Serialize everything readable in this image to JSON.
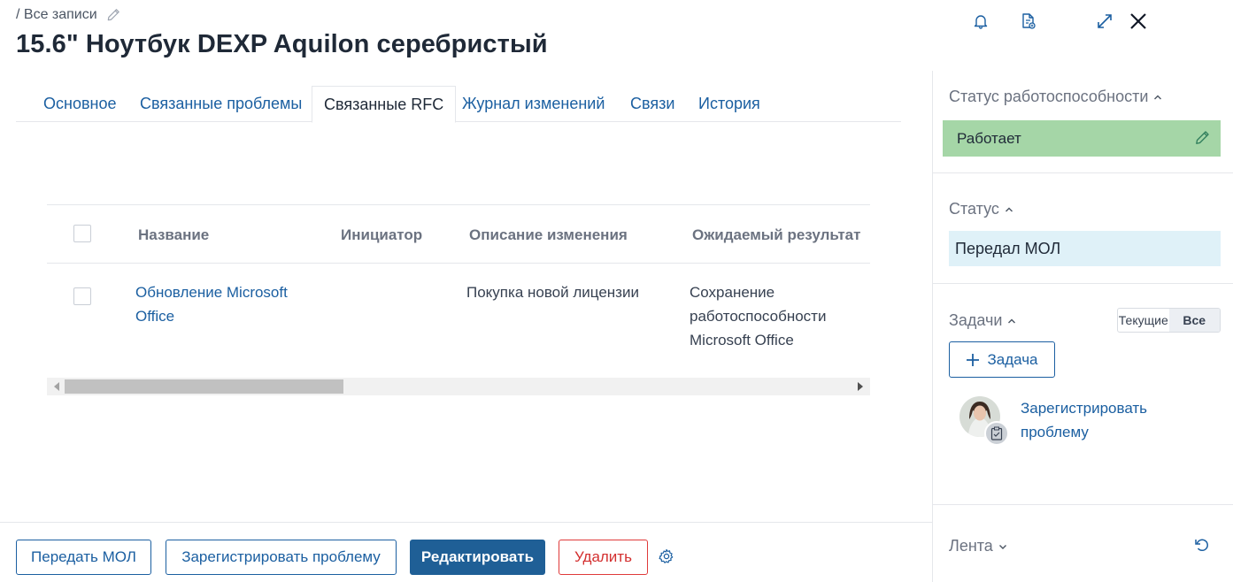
{
  "breadcrumb": {
    "text": "/ Все записи"
  },
  "title": "15.6\" Ноутбук DEXP Aquilon серебристый",
  "tabs": [
    {
      "label": "Основное"
    },
    {
      "label": "Связанные проблемы"
    },
    {
      "label": "Связанные RFC",
      "active": true
    },
    {
      "label": "Журнал изменений"
    },
    {
      "label": "Связи"
    },
    {
      "label": "История"
    }
  ],
  "table": {
    "columns": [
      "Название",
      "Инициатор",
      "Описание изменения",
      "Ожидаемый результат"
    ],
    "rows": [
      {
        "name_line1": "Обновление Microsoft",
        "name_line2": "Office",
        "initiator": "",
        "description": "Покупка новой лицензии",
        "result_line1": "Сохранение",
        "result_line2": "работоспособности",
        "result_line3": "Microsoft Office"
      }
    ]
  },
  "footer": {
    "transfer": "Передать МОЛ",
    "register": "Зарегистрировать проблему",
    "edit": "Редактировать",
    "delete": "Удалить"
  },
  "sidebar": {
    "health": {
      "title": "Статус работоспособности",
      "value": "Работает",
      "color": "#a5d6a7"
    },
    "status": {
      "title": "Статус",
      "value": "Передал МОЛ",
      "color": "#dff1f8"
    },
    "tasks": {
      "title": "Задачи",
      "filter_current": "Текущие",
      "filter_all": "Все",
      "add_label": "Задача",
      "item_line1": "Зарегистрировать",
      "item_line2": "проблему"
    },
    "feed": {
      "title": "Лента"
    }
  },
  "colors": {
    "accent": "#1b5fa1",
    "primary_button": "#1f5f96",
    "danger": "#d32f2f"
  }
}
